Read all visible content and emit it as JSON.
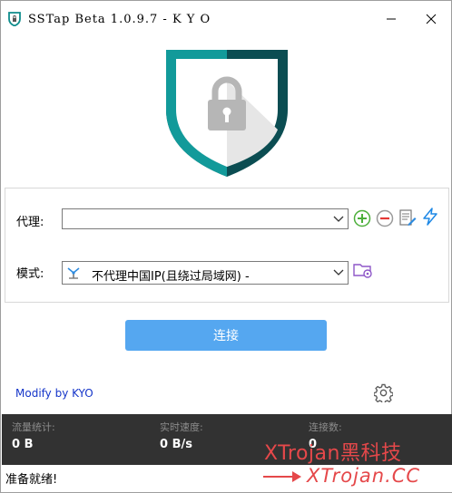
{
  "window": {
    "title": "SSTap Beta 1.0.9.7 - K Y O"
  },
  "colors": {
    "accent": "#55a7f0",
    "shield_teal": "#0e8c8c",
    "shield_dark": "#0b4d52",
    "stats_bg": "#323232",
    "watermark": "#e5484a",
    "link": "#1535c9"
  },
  "proxy": {
    "label": "代理:",
    "value": ""
  },
  "mode": {
    "label": "模式:",
    "value": "不代理中国IP(且绕过局域网) -"
  },
  "icons": {
    "add": "add-proxy-icon",
    "remove": "remove-proxy-icon",
    "edit": "edit-proxy-icon",
    "flash": "flash-icon",
    "mode_edit": "mode-edit-icon",
    "settings": "gear-icon"
  },
  "connect_label": "连接",
  "modify_text": "Modify by KYO",
  "stats": {
    "traffic_label": "流量统计:",
    "traffic_value": "0 B",
    "speed_label": "实时速度:",
    "speed_value": "0 B/s",
    "connections_label": "连接数:",
    "connections_value": "0"
  },
  "status": "准备就绪!",
  "watermark": {
    "line1": "XTrojan黑科技",
    "line2": "XTrojan.CC"
  }
}
